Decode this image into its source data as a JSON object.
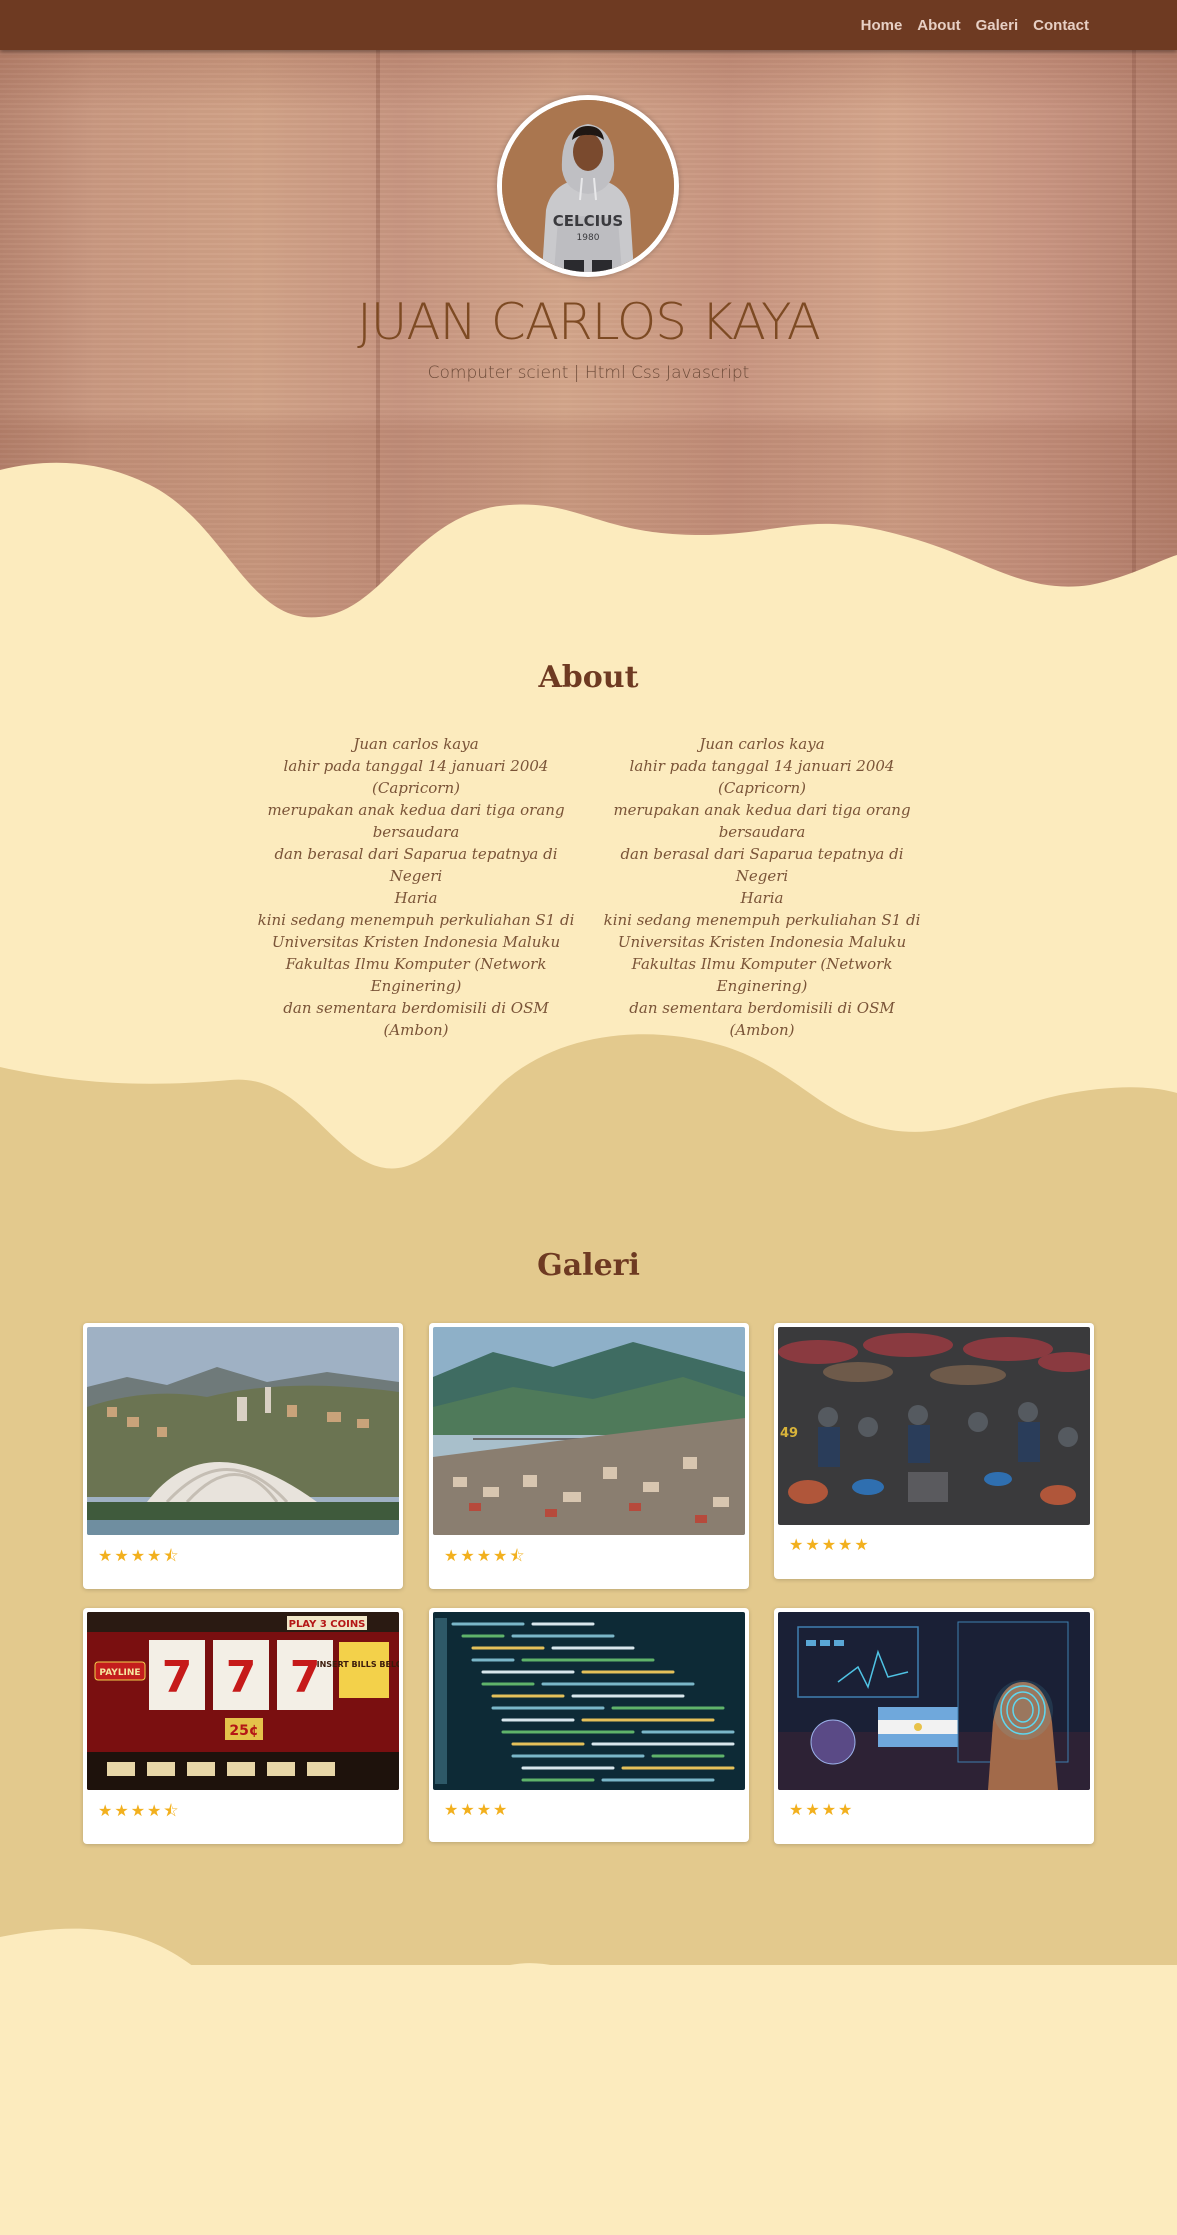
{
  "nav": {
    "links": [
      "Home",
      "About",
      "Galeri",
      "Contact"
    ]
  },
  "hero": {
    "avatar_icon": "person-in-hoodie-photo",
    "name": "JUAN CARLOS KAYA",
    "subtitle": "Computer scient | Html Css Javascript",
    "hoodie_text": "CELCIUS",
    "hoodie_year": "1980"
  },
  "about": {
    "title": "About",
    "columns": [
      {
        "lines": [
          "Juan carlos kaya",
          "lahir pada tanggal 14 januari 2004",
          "(Capricorn)",
          "merupakan anak kedua dari tiga orang",
          "bersaudara",
          "dan berasal dari Saparua tepatnya di Negeri",
          "Haria",
          "kini sedang menempuh perkuliahan S1 di",
          "Universitas Kristen Indonesia Maluku",
          "Fakultas Ilmu Komputer (Network Enginering)",
          "dan sementara berdomisili di OSM (Ambon)"
        ]
      },
      {
        "lines": [
          "Juan carlos kaya",
          "lahir pada tanggal 14 januari 2004",
          "(Capricorn)",
          "merupakan anak kedua dari tiga orang",
          "bersaudara",
          "dan berasal dari Saparua tepatnya di Negeri",
          "Haria",
          "kini sedang menempuh perkuliahan S1 di",
          "Universitas Kristen Indonesia Maluku",
          "Fakultas Ilmu Komputer (Network Enginering)",
          "dan sementara berdomisili di OSM (Ambon)"
        ]
      }
    ]
  },
  "gallery": {
    "title": "Galeri",
    "cards": [
      {
        "image": "city-harbor-dome-photo",
        "rating": 4.5,
        "stars": "★★★★⯪"
      },
      {
        "image": "bay-city-mountains-photo",
        "rating": 4.5,
        "stars": "★★★★⯪"
      },
      {
        "image": "market-umbrellas-photo",
        "rating": 5,
        "stars": "★★★★★"
      },
      {
        "image": "slot-machine-photo",
        "rating": 4.5,
        "stars": "★★★★⯪",
        "slot_text": "777",
        "payline": "PAYLINE",
        "bet": "25¢",
        "play_label": "PLAY 3 COINS",
        "insert_label": "INSERT BILLS BELOW"
      },
      {
        "image": "code-screen-photo",
        "rating": 4,
        "stars": "★★★★"
      },
      {
        "image": "fingerprint-tech-photo",
        "rating": 4,
        "stars": "★★★★"
      }
    ]
  },
  "colors": {
    "navbar": "#6e3a22",
    "cream": "#fcebbe",
    "sand": "#e3c98d",
    "accent_brown": "#6e3a22",
    "star": "#f2b01e"
  }
}
